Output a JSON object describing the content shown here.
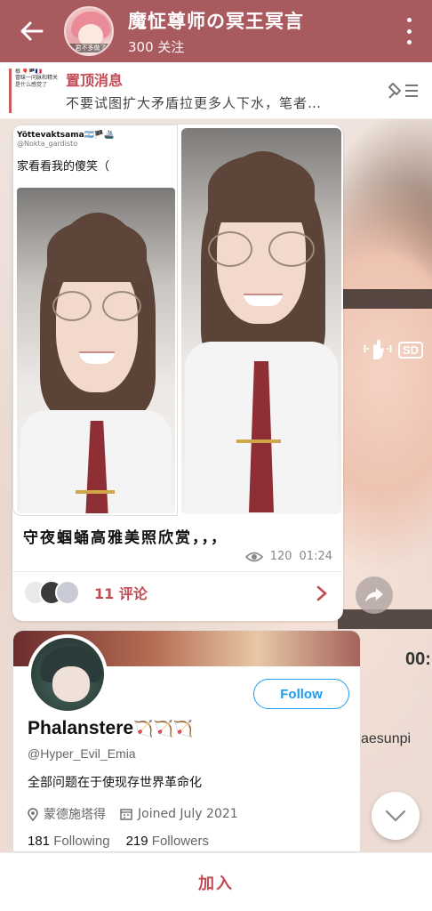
{
  "header": {
    "title": "魔怔尊师の冥王冥言",
    "subtitle": "300 关注",
    "avatar_caption": "君不多做了"
  },
  "pinned": {
    "title": "置顶消息",
    "text": "不要试图扩大矛盾拉更多人下水，笔者…",
    "thumb_line1": "根 🎈🏴🇫🇷",
    "thumb_line2": "冒昧一问脉和精关",
    "thumb_line3": "是什么感觉了"
  },
  "post": {
    "tweet_author": "Yöttevaktsama🇦🇷🏴🚢",
    "tweet_handle": "@Nokta_gardisto",
    "tweet_text": "家看看我的傻笑（",
    "caption": "守夜蝈蛹高雅美照欣赏，，，",
    "views": "120",
    "time": "01:24",
    "comments": "11 评论"
  },
  "profile": {
    "follow_label": "Follow",
    "name": "Phalanstere",
    "name_emoji": "🏹🏹🏹",
    "handle": "@Hyper_Evil_Emia",
    "bio": "全部问题在于使现存世界革命化",
    "location": "蒙德施塔得",
    "joined": "Joined July 2021",
    "following_count": "181",
    "following_label": "Following",
    "followers_count": "219",
    "followers_label": "Followers"
  },
  "background": {
    "sd_label": "SD",
    "timecode": "00:",
    "watermark": "aesunpi"
  },
  "join_label": "加入",
  "colors": {
    "header_bg": "#a85a5f",
    "accent": "#c24b55",
    "twitter_blue": "#1d9bf0"
  }
}
